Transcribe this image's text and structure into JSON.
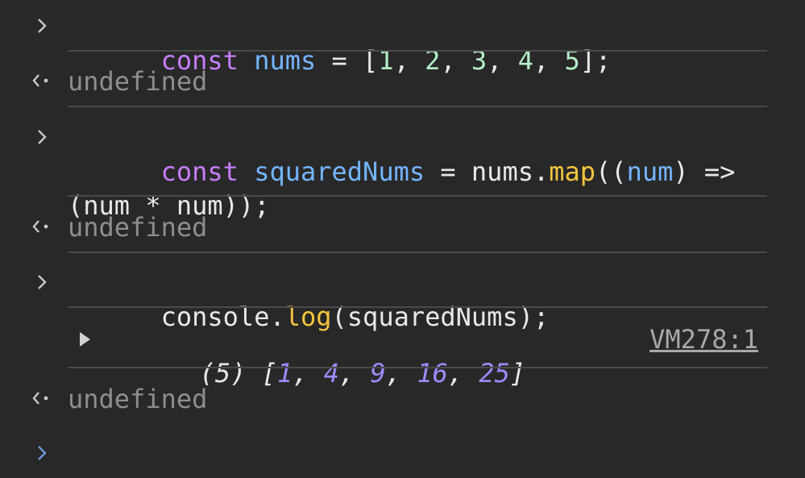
{
  "console": {
    "entries": [
      {
        "kind": "input",
        "tokens": {
          "t1": "const",
          "t2": " ",
          "t3": "nums",
          "t4": " = [",
          "t5": "1",
          "t6": ", ",
          "t7": "2",
          "t8": ", ",
          "t9": "3",
          "t10": ", ",
          "t11": "4",
          "t12": ", ",
          "t13": "5",
          "t14": "];"
        }
      },
      {
        "kind": "result",
        "text": "undefined"
      },
      {
        "kind": "input",
        "tokens": {
          "t1": "const",
          "t2": " ",
          "t3": "squaredNums",
          "t4": " = nums.",
          "t5": "map",
          "t6": "((",
          "t7": "num",
          "t8": ") => (num * num));"
        }
      },
      {
        "kind": "result",
        "text": "undefined"
      },
      {
        "kind": "input",
        "tokens": {
          "t1": "console.",
          "t2": "log",
          "t3": "(squaredNums);"
        }
      },
      {
        "kind": "log",
        "preview": {
          "count": "(5)",
          "open": " [",
          "v1": "1",
          "v2": "4",
          "v3": "9",
          "v4": "16",
          "v5": "25",
          "sep": ", ",
          "close": "]"
        },
        "source": "VM278:1"
      },
      {
        "kind": "result",
        "text": "undefined"
      }
    ],
    "prompt": ""
  },
  "colors": {
    "background": "#282828",
    "keyword": "#c77dff",
    "variable": "#74b5ff",
    "number_literal": "#b6f0c7",
    "function": "#f4c63e",
    "array_number": "#9b8cff",
    "result_gray": "#8e8e8e",
    "prompt_blue": "#6c9bd8"
  },
  "icons": {
    "input_prompt": "chevron-right-icon",
    "result": "return-arrow-icon",
    "expander": "triangle-right-icon",
    "active_prompt": "chevron-right-icon"
  }
}
